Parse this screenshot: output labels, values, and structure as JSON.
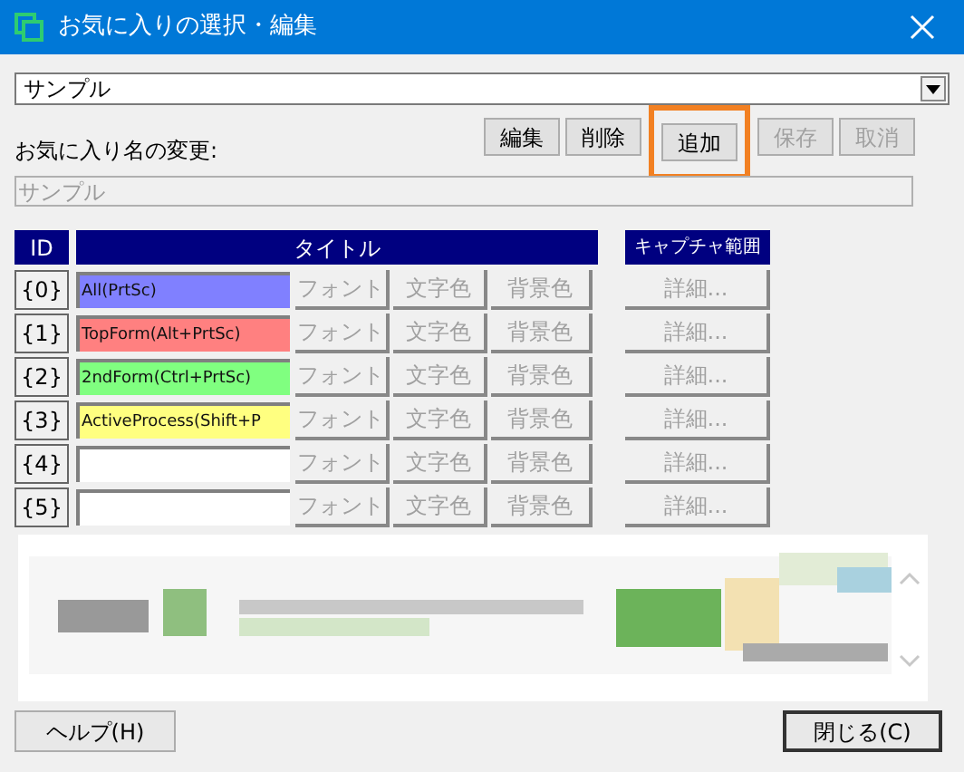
{
  "window": {
    "title": "お気に入りの選択・編集"
  },
  "favorite_select": {
    "value": "サンプル"
  },
  "rename": {
    "label": "お気に入り名の変更:",
    "value": "サンプル",
    "disabled": true
  },
  "buttons": [
    {
      "label": "編集",
      "disabled": false,
      "highlighted": false
    },
    {
      "label": "削除",
      "disabled": false,
      "highlighted": false
    },
    {
      "label": "追加",
      "disabled": false,
      "highlighted": true
    },
    {
      "label": "保存",
      "disabled": true,
      "highlighted": false
    },
    {
      "label": "取消",
      "disabled": true,
      "highlighted": false
    }
  ],
  "table": {
    "columns": [
      "ID",
      "タイトル",
      "キャプチャ範囲"
    ],
    "rows": [
      {
        "id": "{0}",
        "title": "All(PrtSc)",
        "color": "#8080ff",
        "font": "フォント",
        "text_color_button": "文字色",
        "bg_button": "背景色",
        "detail": "詳細...",
        "disabled": true
      },
      {
        "id": "{1}",
        "title": "TopForm(Alt+PrtSc)",
        "color": "#ff8080",
        "font": "フォント",
        "text_color_button": "文字色",
        "bg_button": "背景色",
        "detail": "詳細...",
        "disabled": true
      },
      {
        "id": "{2}",
        "title": "2ndForm(Ctrl+PrtSc)",
        "color": "#80ff80",
        "font": "フォント",
        "text_color_button": "文字色",
        "bg_button": "背景色",
        "detail": "詳細...",
        "disabled": true
      },
      {
        "id": "{3}",
        "title": "ActiveProcess(Shift+P",
        "color": "#ffff80",
        "font": "フォント",
        "text_color_button": "文字色",
        "bg_button": "背景色",
        "detail": "詳細...",
        "disabled": true
      },
      {
        "id": "{4}",
        "font": "フォント",
        "text_color_button": "文字色",
        "bg_button": "背景色",
        "detail": "詳細...",
        "disabled": true
      },
      {
        "id": "{5}",
        "font": "フォント",
        "text_color_button": "文字色",
        "bg_button": "背景色",
        "detail": "詳細...",
        "disabled": true
      }
    ]
  },
  "footer": {
    "help": "ヘルプ(H)",
    "close": "閉じる(C)"
  }
}
